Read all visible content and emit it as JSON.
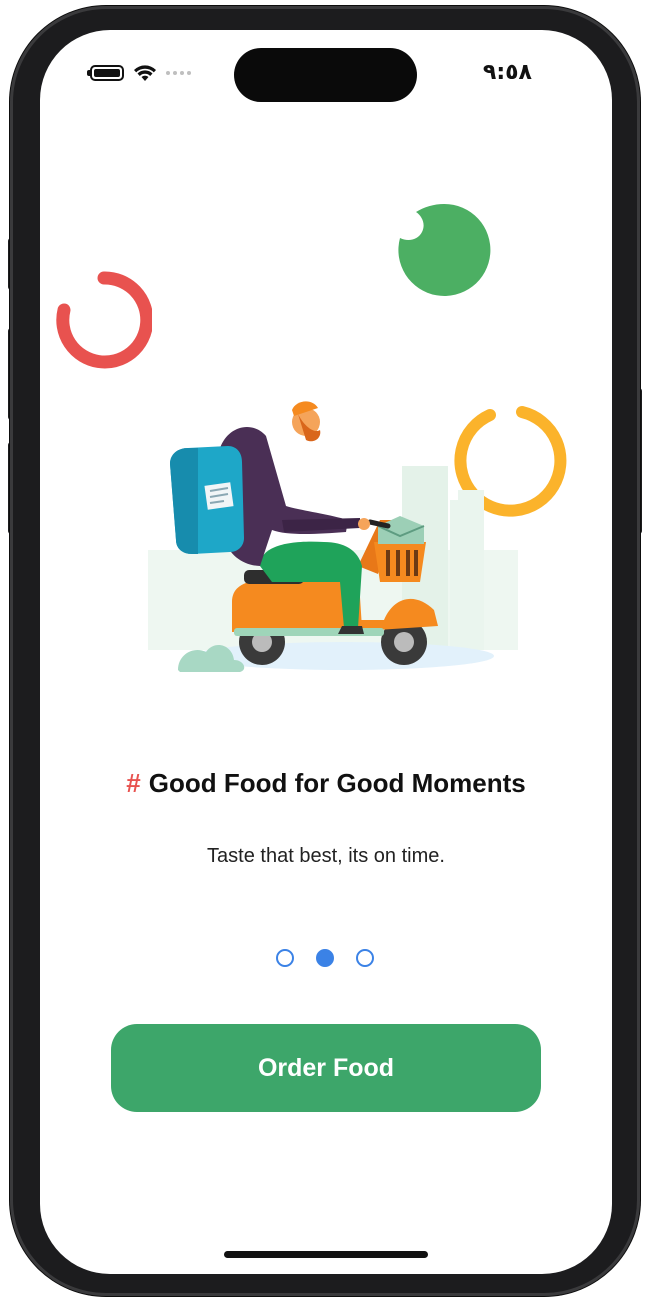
{
  "status_bar": {
    "time": "٩:٥٨"
  },
  "onboarding": {
    "title_hash": "#",
    "title": "Good Food for Good Moments",
    "subtitle": "Taste that best, its on time.",
    "page_count": 3,
    "active_page": 2
  },
  "actions": {
    "order_label": "Order Food"
  },
  "colors": {
    "accent_green": "#3da66a",
    "accent_red": "#e8524f",
    "accent_yellow": "#fbb32b",
    "pager_blue": "#3b82e6"
  },
  "icons": {
    "battery": "battery-icon",
    "wifi": "wifi-icon",
    "signal": "signal-icon"
  }
}
